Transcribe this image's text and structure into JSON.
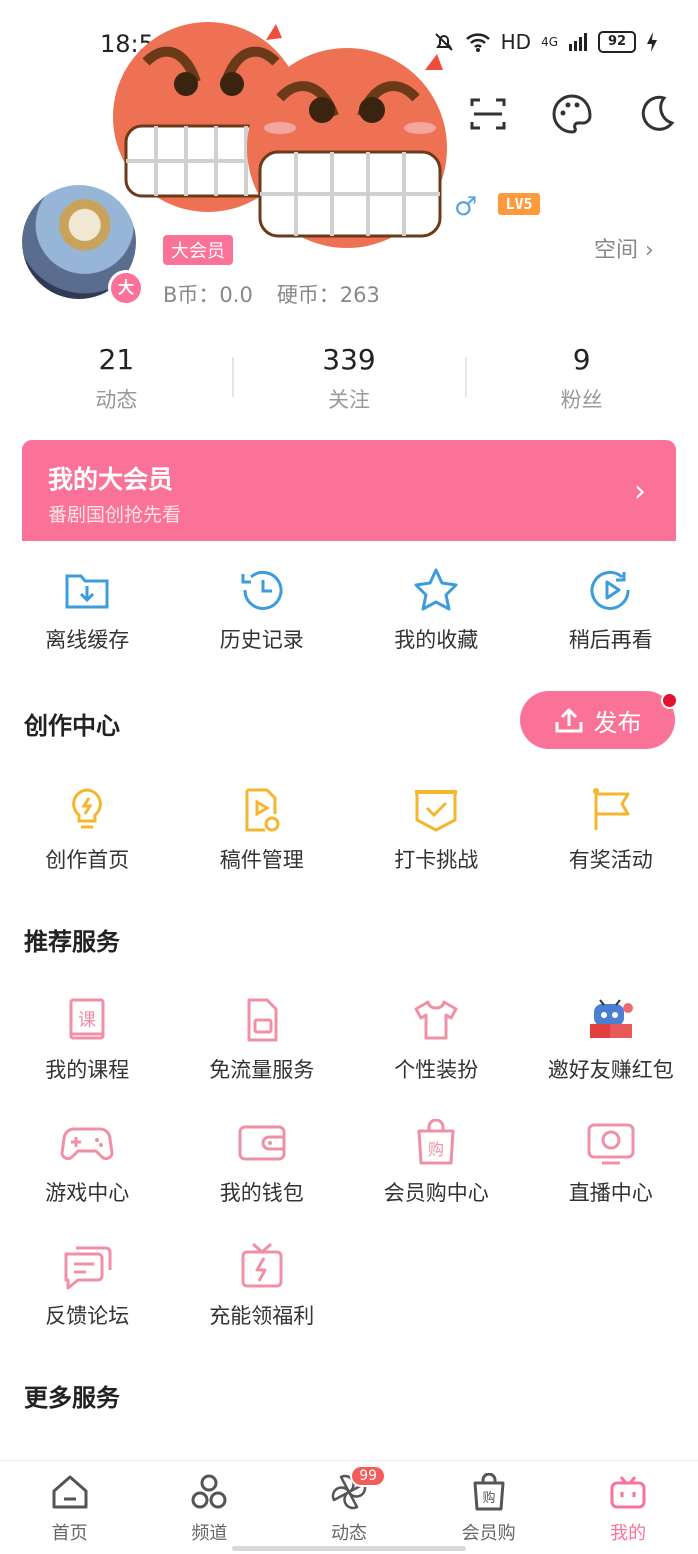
{
  "status": {
    "time": "18:5",
    "network": "HD",
    "cell": "4G",
    "battery": "92"
  },
  "profile": {
    "vip_tag": "大会员",
    "avatar_badge": "大",
    "level": "LV5",
    "gender": "♂",
    "space_link": "空间 ›",
    "bcoin": "B币：0.0",
    "coin": "硬币：263"
  },
  "stats": [
    {
      "num": "21",
      "label": "动态"
    },
    {
      "num": "339",
      "label": "关注"
    },
    {
      "num": "9",
      "label": "粉丝"
    }
  ],
  "vip_banner": {
    "title": "我的大会员",
    "subtitle": "番剧国创抢先看",
    "chevron": "›"
  },
  "quick": [
    {
      "label": "离线缓存",
      "icon": "download-folder-icon"
    },
    {
      "label": "历史记录",
      "icon": "history-clock-icon"
    },
    {
      "label": "我的收藏",
      "icon": "star-icon"
    },
    {
      "label": "稍后再看",
      "icon": "watch-later-icon"
    }
  ],
  "creation": {
    "title": "创作中心",
    "publish": "发布",
    "items": [
      {
        "label": "创作首页",
        "icon": "lightbulb-icon"
      },
      {
        "label": "稿件管理",
        "icon": "manuscript-icon"
      },
      {
        "label": "打卡挑战",
        "icon": "check-in-icon"
      },
      {
        "label": "有奖活动",
        "icon": "flag-icon"
      }
    ]
  },
  "recommend": {
    "title": "推荐服务",
    "items": [
      {
        "label": "我的课程",
        "icon": "course-book-icon",
        "glyph": "课"
      },
      {
        "label": "免流量服务",
        "icon": "sim-card-icon"
      },
      {
        "label": "个性装扮",
        "icon": "tshirt-icon"
      },
      {
        "label": "邀好友赚红包",
        "icon": "mascot-icon"
      },
      {
        "label": "游戏中心",
        "icon": "gamepad-icon"
      },
      {
        "label": "我的钱包",
        "icon": "wallet-icon"
      },
      {
        "label": "会员购中心",
        "icon": "shopping-bag-icon",
        "glyph": "购"
      },
      {
        "label": "直播中心",
        "icon": "live-tv-icon"
      },
      {
        "label": "反馈论坛",
        "icon": "feedback-chat-icon"
      },
      {
        "label": "充能领福利",
        "icon": "charge-gift-icon"
      }
    ]
  },
  "more": {
    "title": "更多服务"
  },
  "tabs": [
    {
      "label": "首页",
      "icon": "home-icon"
    },
    {
      "label": "频道",
      "icon": "channel-icon"
    },
    {
      "label": "动态",
      "icon": "pinwheel-icon",
      "badge": "99"
    },
    {
      "label": "会员购",
      "icon": "shopping-bag-icon",
      "glyph": "购"
    },
    {
      "label": "我的",
      "icon": "tv-mascot-icon",
      "active": true
    }
  ],
  "colors": {
    "pink": "#fb7299",
    "blue": "#3c9cdc",
    "yellow": "#f5b52d"
  }
}
